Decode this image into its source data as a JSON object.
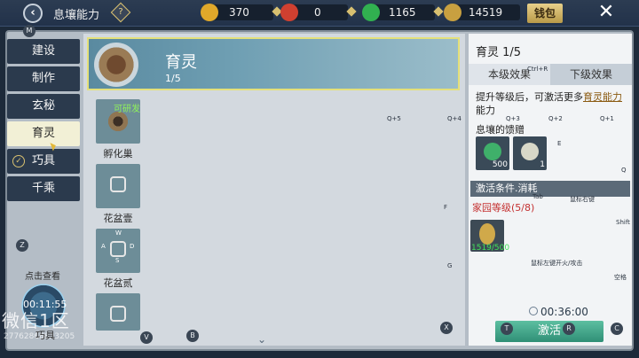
{
  "header": {
    "title": "息壤能力",
    "resources": [
      {
        "name": "gold",
        "value": "370",
        "color": "#e0a82a"
      },
      {
        "name": "red",
        "value": "0",
        "color": "#d04030"
      },
      {
        "name": "green",
        "value": "1165",
        "color": "#31b150"
      },
      {
        "name": "seed",
        "value": "14519",
        "color": "#c8a040"
      }
    ],
    "wallet_label": "钱包",
    "back_glyph": "‹",
    "help_glyph": "?",
    "close_glyph": "✕"
  },
  "sidebar": {
    "items": [
      {
        "label": "建设"
      },
      {
        "label": "制作"
      },
      {
        "label": "玄秘"
      },
      {
        "label": "育灵"
      },
      {
        "label": "巧具"
      },
      {
        "label": "千乘"
      }
    ],
    "watch_label": "点击查看",
    "timer": "00:11:55",
    "tool_label": "巧具",
    "check_glyph": "✓"
  },
  "banner": {
    "title": "育灵",
    "count": "1/5"
  },
  "items": [
    {
      "name": "孵化巢",
      "tag": "可研发"
    },
    {
      "name": "花盆壹"
    },
    {
      "name": "花盆贰"
    },
    {
      "name": ""
    }
  ],
  "detail": {
    "title": "育灵 1/5",
    "tabs": [
      "本级效果",
      "下级效果"
    ],
    "desc_prefix": "提升等级后，可激活更多",
    "desc_link": "育灵能力",
    "desc_suffix": "能力",
    "gift_title": "息壤的馈赠",
    "gifts": [
      {
        "count": "500"
      },
      {
        "count": "1"
      }
    ],
    "activate_section": "激活条件.消耗",
    "requirement": "家园等级(5/8)",
    "material_count": "1519/500",
    "cooldown": "00:36:00",
    "activate_label": "激活"
  },
  "watermark": {
    "text": "微信1区",
    "id": "27762868833205"
  },
  "key_hints": {
    "m": "M",
    "z": "Z",
    "q5": "Q+5",
    "q4": "Q+4",
    "q3": "Q+3",
    "q2": "Q+2",
    "q1": "Q+1",
    "ctrlr": "Ctrl+R",
    "e": "E",
    "q": "Q",
    "tab": "Tab",
    "mouse_right": "鼠标右键",
    "f": "F",
    "shift": "Shift",
    "g": "G",
    "mouse_left": "鼠标左键开火/攻击",
    "space": "空格",
    "w": "W",
    "a": "A",
    "s": "S",
    "d": "D",
    "v": "V",
    "b": "B",
    "x": "X",
    "t": "T",
    "r": "R",
    "c": "C"
  }
}
